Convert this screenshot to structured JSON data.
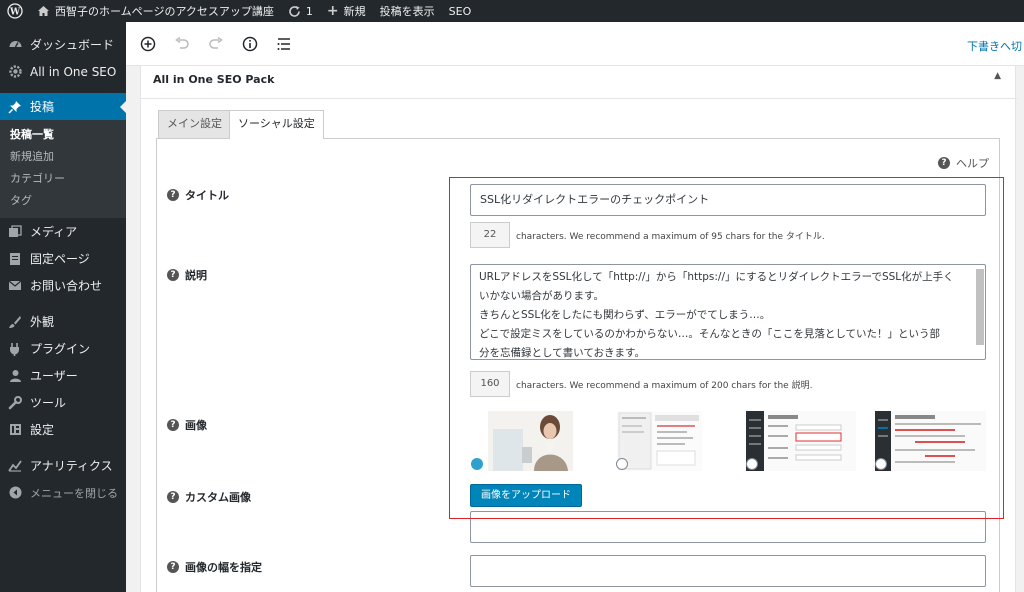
{
  "adminbar": {
    "site_title": "西智子のホームページのアクセスアップ講座",
    "updates_count": "1",
    "new_label": "新規",
    "view_post_label": "投稿を表示",
    "seo_label": "SEO"
  },
  "sidebar": {
    "items": [
      {
        "label": "ダッシュボード",
        "icon": "dashboard-icon"
      },
      {
        "label": "All in One SEO",
        "icon": "gear-icon"
      },
      {
        "label": "投稿",
        "icon": "pin-icon"
      }
    ],
    "posts_submenu": [
      "投稿一覧",
      "新規追加",
      "カテゴリー",
      "タグ"
    ],
    "items_after": [
      {
        "label": "メディア",
        "icon": "media-icon"
      },
      {
        "label": "固定ページ",
        "icon": "page-icon"
      },
      {
        "label": "お問い合わせ",
        "icon": "mail-icon"
      },
      {
        "label": "外観",
        "icon": "brush-icon"
      },
      {
        "label": "プラグイン",
        "icon": "plugin-icon"
      },
      {
        "label": "ユーザー",
        "icon": "user-icon"
      },
      {
        "label": "ツール",
        "icon": "wrench-icon"
      },
      {
        "label": "設定",
        "icon": "settings-icon"
      },
      {
        "label": "アナリティクス",
        "icon": "analytics-icon"
      }
    ],
    "collapse_label": "メニューを閉じる"
  },
  "editor": {
    "save_draft": "下書きへ切"
  },
  "metabox": {
    "title": "All in One SEO Pack",
    "tabs": [
      "メイン設定",
      "ソーシャル設定"
    ],
    "help_label": "ヘルプ",
    "fields": {
      "title_label": "タイトル",
      "title_value": "SSL化リダイレクトエラーのチェックポイント",
      "title_count": "22",
      "title_note": "characters. We recommend a maximum of 95 chars for the タイトル.",
      "desc_label": "説明",
      "desc_lines": [
        "URLアドレスをSSL化して「http://」から「https://」にするとリダイレクトエラーでSSL化が上手く",
        "いかない場合があります。",
        "きちんとSSL化をしたにも関わらず、エラーがでてしまう…。",
        "どこで設定ミスをしているのかわからない…。そんなときの「ここを見落としていた！」という部",
        "分を忘備録として書いておきます。"
      ],
      "desc_count": "160",
      "desc_note": "characters. We recommend a maximum of 200 chars for the 説明.",
      "image_label": "画像",
      "custom_image_label": "カスタム画像",
      "upload_button": "画像をアップロード",
      "image_width_label": "画像の幅を指定"
    }
  },
  "colors": {
    "accent": "#0073aa",
    "admin_bg": "#23282d",
    "highlight": "#d9252a",
    "button": "#0085ba"
  }
}
